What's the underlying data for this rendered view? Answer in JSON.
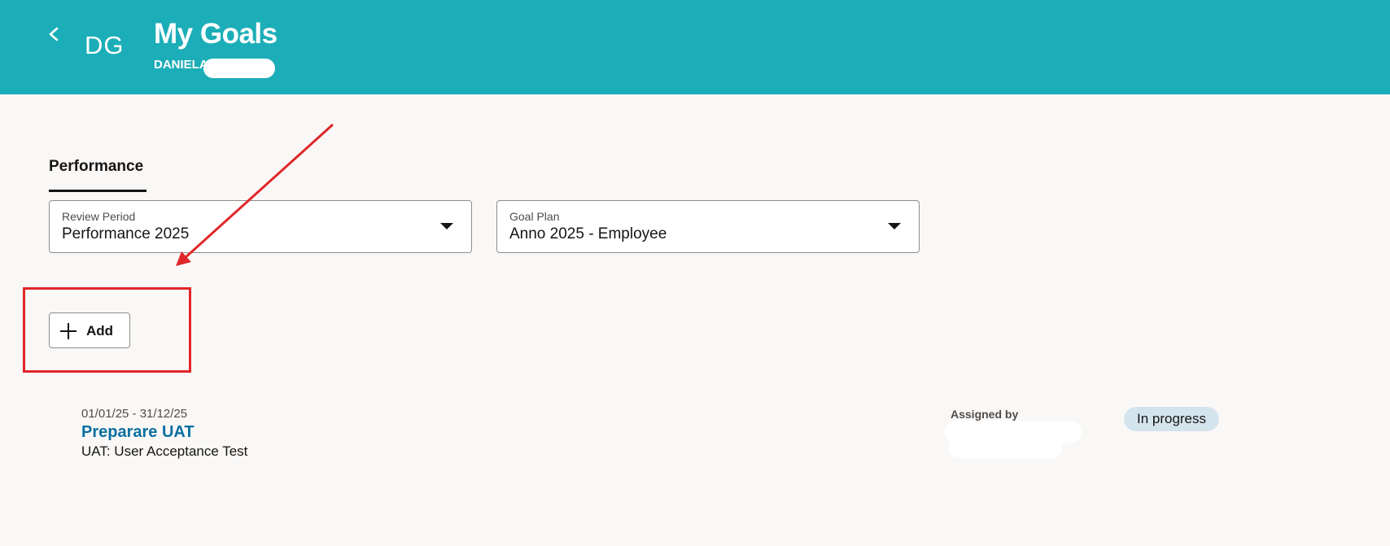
{
  "header": {
    "avatar_initials": "DG",
    "title": "My Goals",
    "user_name": "DANIELA",
    "background_color": "#1caeb8",
    "back_icon": "chevron-left-icon"
  },
  "tabs": [
    {
      "label": "Performance",
      "selected": true
    }
  ],
  "filters": {
    "review_period": {
      "label": "Review Period",
      "value": "Performance 2025"
    },
    "goal_plan": {
      "label": "Goal Plan",
      "value": "Anno 2025 - Employee"
    }
  },
  "toolbar": {
    "add_label": "Add",
    "add_icon": "plus-icon"
  },
  "goals": [
    {
      "dates": "01/01/25 - 31/12/25",
      "name": "Preparare UAT",
      "description": "UAT: User Acceptance Test",
      "assigned_by_label": "Assigned by",
      "status": "In progress"
    }
  ],
  "annotation": {
    "color": "#e0262a"
  }
}
